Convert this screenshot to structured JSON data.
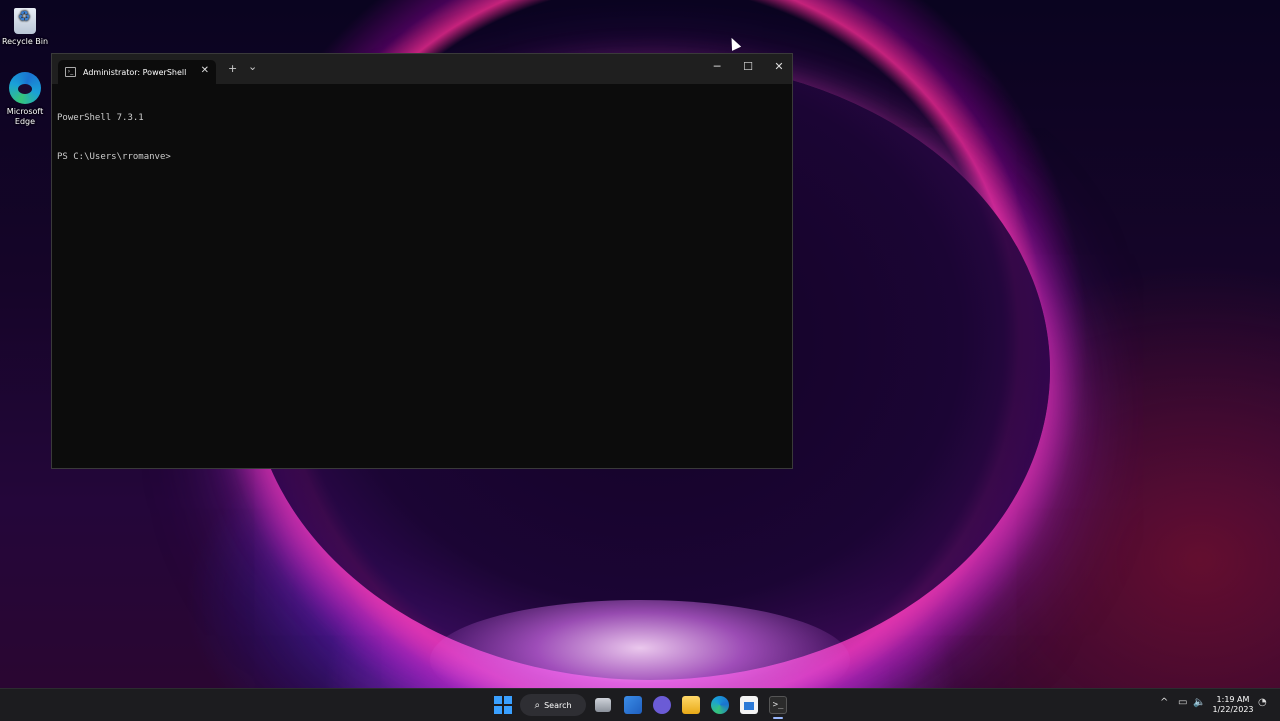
{
  "desktop": {
    "icons": [
      {
        "label": "Recycle Bin"
      },
      {
        "label": "Microsoft Edge"
      }
    ]
  },
  "window": {
    "tab_title": "Administrator: PowerShell",
    "new_tab": "+",
    "dropdown": "⌄",
    "tab_close": "✕",
    "minimize": "─",
    "maximize": "☐",
    "close": "✕"
  },
  "terminal": {
    "lines": [
      "PowerShell 7.3.1",
      "PS C:\\Users\\rromanve>"
    ]
  },
  "taskbar": {
    "search_label": "Search",
    "search_icon": "⌕",
    "terminal_glyph": ">_",
    "tray": {
      "chevron": "^",
      "network": "▭",
      "volume": "🔈"
    },
    "time": "1:19 AM",
    "date": "1/22/2023"
  },
  "colors": {
    "accent": "#3aa0ff",
    "terminal_bg": "#0c0c0c",
    "titlebar_bg": "#1f1f1f",
    "taskbar_bg": "#1c1c1f"
  }
}
